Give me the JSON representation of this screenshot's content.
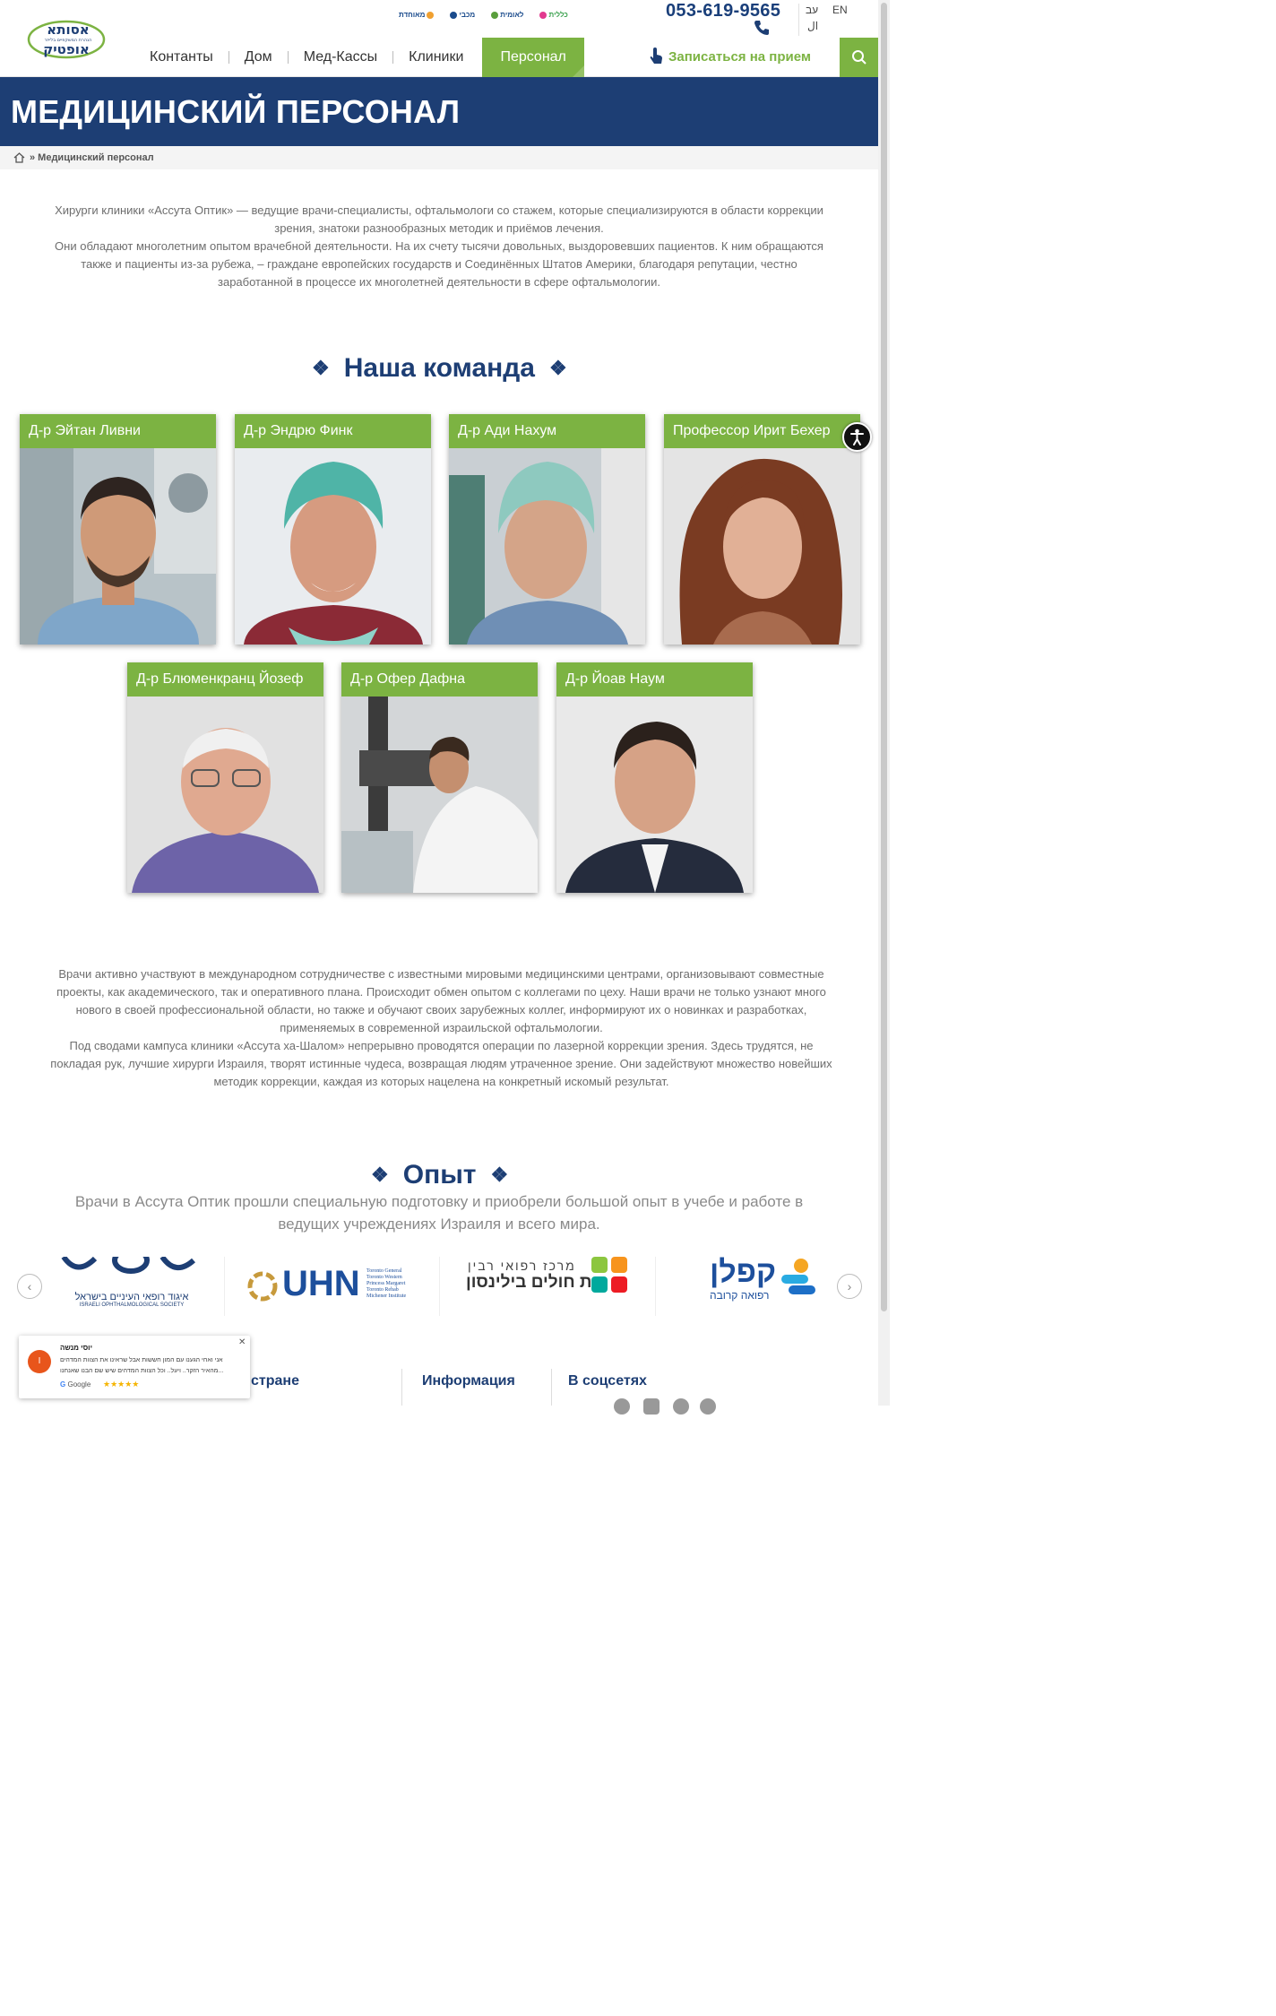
{
  "header": {
    "logo_alt": "אסותא אופטיק",
    "phone": "053-619-9565",
    "lang_he": "עב",
    "lang_en": "EN",
    "lang_ar": "ال",
    "partners": [
      "מאוחדת",
      "מכבי",
      "לאומית",
      "כללית"
    ],
    "nav": [
      "Контанты",
      "Дом",
      "Мед-Кассы",
      "Клиники",
      "Персонал"
    ],
    "appointment": "Записаться на прием"
  },
  "hero": {
    "title": "МЕДИЦИНСКИЙ ПЕРСОНАЛ"
  },
  "breadcrumb": {
    "current": "» Медицинский персонал"
  },
  "intro": {
    "p1": "Хирурги клиники «Ассута Оптик» — ведущие врачи-специалисты, офтальмологи со стажем, которые специализируются в области коррекции зрения, знатоки разнообразных методик и приёмов лечения.",
    "p2": "Они обладают многолетним опытом врачебной деятельности. На их счету тысячи довольных, выздоровевших пациентов. К ним обращаются также и пациенты из-за рубежа, – граждане европейских государств и Соединённых Штатов Америки, благодаря репутации, честно заработанной в процессе их многолетней деятельности в сфере офтальмологии."
  },
  "team": {
    "title": "Наша команда",
    "doctors": [
      "Д-р Эйтан Ливни",
      "Д-р Эндрю Финк",
      "Д-р Ади Нахум",
      "Профессор Ирит Бехер",
      "Д-р Блюменкранц Йозеф",
      "Д-р Офер Дафна",
      "Д-р Йоав Наум"
    ]
  },
  "about": {
    "p1": "Врачи активно участвуют в международном сотрудничестве с известными мировыми медицинскими центрами, организовывают совместные проекты, как академического, так и оперативного плана. Происходит обмен опытом с коллегами по цеху. Наши врачи не только узнают много нового в своей профессиональной области, но также и обучают своих зарубежных коллег, информируют их о новинках и разработках, применяемых в современной израильской офтальмологии.",
    "p2": "Под сводами кампуса клиники «Ассута ха-Шалом» непрерывно проводятся операции по лазерной коррекции зрения. Здесь трудятся, не покладая рук, лучшие хирурги Израиля, творят истинные чудеса, возвращая людям утраченное зрение. Они задействуют множество новейших методик коррекции, каждая из которых нацелена на конкретный искомый результат."
  },
  "experience": {
    "title": "Опыт",
    "subtitle": "Врачи в Ассута Оптик прошли специальную подготовку и приобрели большой опыт в учебе и работе в ведущих учреждениях Израиля и всего мира.",
    "logos": {
      "ios_he": "איגוד רופאי העיניים בישראל",
      "ios_en": "ISRAELI OPHTHALMOLOGICAL SOCIETY",
      "uhn": "UHN",
      "uhn_sub": [
        "Toronto General",
        "Toronto Western",
        "Princess Margaret",
        "Toronto Rehab",
        "Michener Institute"
      ],
      "rabin_top": "מרכז רפואי רבין",
      "rabin_bottom": "בית חולים בילינסון",
      "kaplan_top": "קפלן",
      "kaplan_bottom": "רפואה קרובה"
    }
  },
  "review": {
    "author": "יוסי מנשה",
    "text": "אני ואחי הגענו עם המון חששות אבל שראינו את הצוות המדהים מהאיר הזקר.. ויעל.. וכל הצוות המדהים שיש שם הבנו שאנחנו...",
    "source": "Google",
    "stars": "★★★★★",
    "avatar_letter": "I"
  },
  "footer": {
    "col1": "стране",
    "col2": "Информация",
    "col3": "В соцсетях"
  },
  "colors": {
    "navy": "#1d3e74",
    "green": "#7cb342"
  }
}
